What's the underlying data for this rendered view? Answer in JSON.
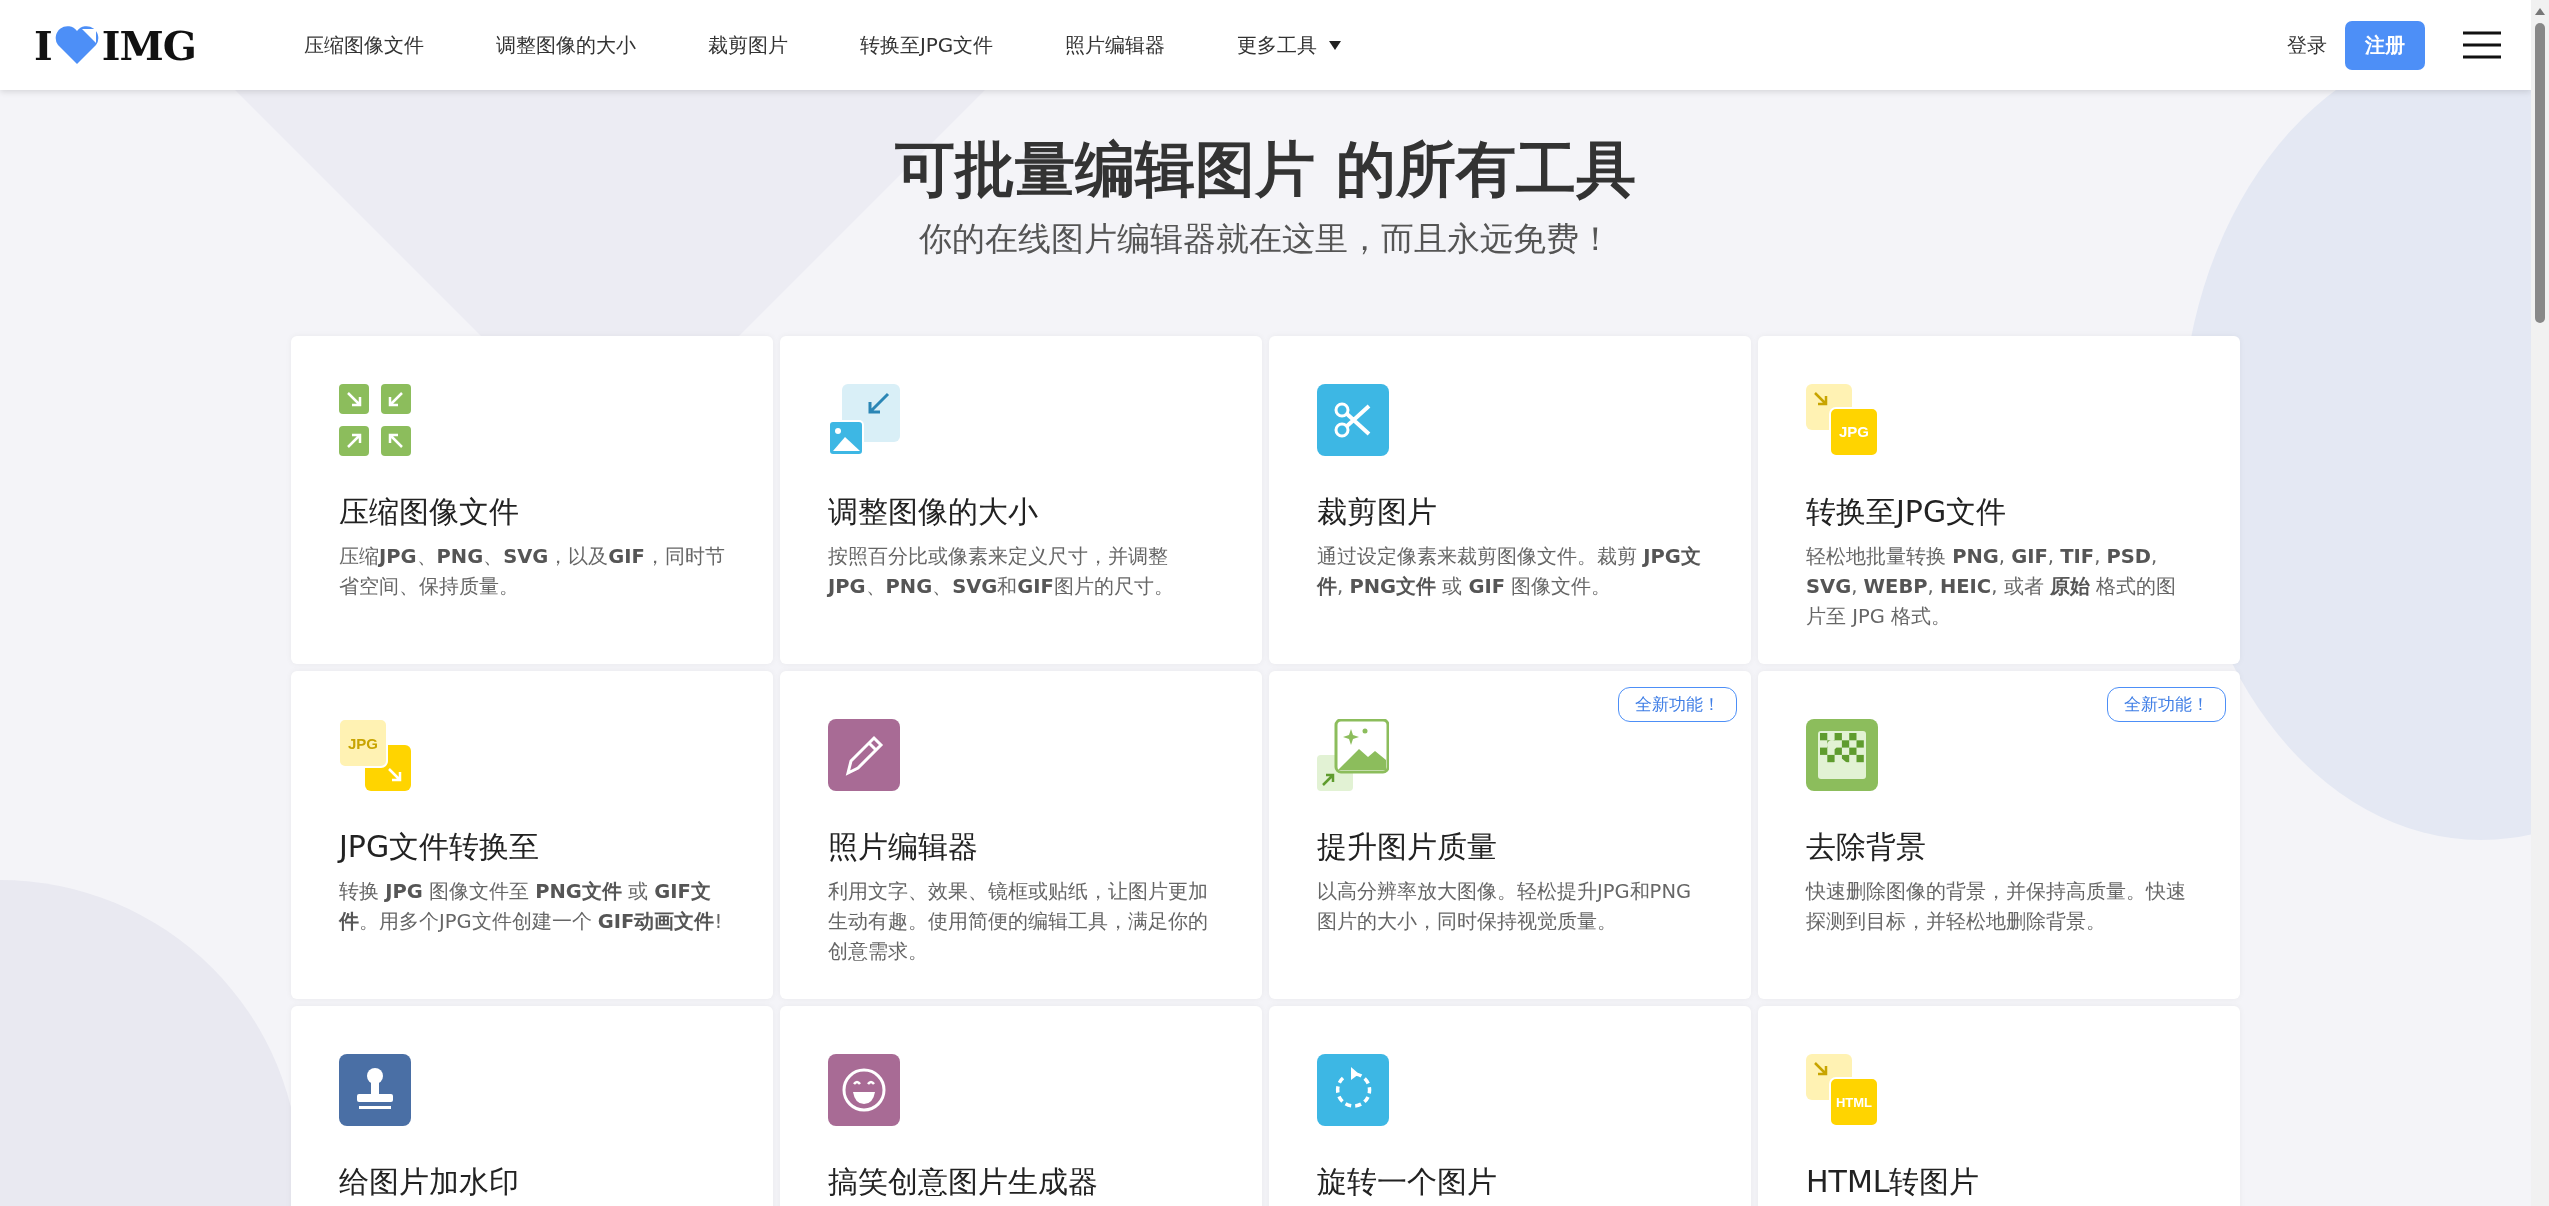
{
  "header": {
    "logo": {
      "left": "I",
      "right": "IMG"
    },
    "nav": [
      {
        "label": "压缩图像文件",
        "dropdown": false
      },
      {
        "label": "调整图像的大小",
        "dropdown": false
      },
      {
        "label": "裁剪图片",
        "dropdown": false
      },
      {
        "label": "转换至JPG文件",
        "dropdown": false
      },
      {
        "label": "照片编辑器",
        "dropdown": false
      },
      {
        "label": "更多工具",
        "dropdown": true
      }
    ],
    "login": "登录",
    "signup": "注册"
  },
  "hero": {
    "title": "可批量编辑图片 的所有工具",
    "subtitle": "你的在线图片编辑器就在这里，而且永远免费！"
  },
  "tools": [
    {
      "kind": "compress",
      "title": "压缩图像文件",
      "description": "压缩**JPG**、**PNG**、**SVG**，以及**GIF**，同时节省空间、保持质量。"
    },
    {
      "kind": "resize",
      "title": "调整图像的大小",
      "description": "按照百分比或像素来定义尺寸，并调整**JPG**、**PNG**、**SVG**和**GIF**图片的尺寸。"
    },
    {
      "kind": "crop",
      "title": "裁剪图片",
      "description": "通过设定像素来裁剪图像文件。裁剪 **JPG文件**, **PNG文件** 或 **GIF** 图像文件。"
    },
    {
      "kind": "to_format",
      "icon_text": "JPG",
      "title": "转换至JPG文件",
      "description": "轻松地批量转换 **PNG**, **GIF**, **TIF**, **PSD**, **SVG**, **WEBP**, **HEIC**, 或者 **原始** 格式的图片至 JPG 格式。"
    },
    {
      "kind": "from_format",
      "icon_text": "JPG",
      "title": "JPG文件转换至",
      "description": "转换 **JPG** 图像文件至 **PNG文件** 或 **GIF文件**。用多个JPG文件创建一个 **GIF动画文件**!"
    },
    {
      "kind": "edit",
      "title": "照片编辑器",
      "description": "利用文字、效果、镜框或贴纸，让图片更加生动有趣。使用简便的编辑工具，满足你的创意需求。"
    },
    {
      "kind": "upscale",
      "badge": "全新功能！",
      "title": "提升图片质量",
      "description": "以高分辨率放大图像。轻松提升JPG和PNG图片的大小，同时保持视觉质量。"
    },
    {
      "kind": "remove_bg",
      "badge": "全新功能！",
      "title": "去除背景",
      "description": "快速删除图像的背景，并保持高质量。快速探测到目标，并轻松地删除背景。"
    },
    {
      "kind": "watermark",
      "title": "给图片加水印"
    },
    {
      "kind": "meme",
      "title": "搞笑创意图片生成器"
    },
    {
      "kind": "rotate",
      "title": "旋转一个图片"
    },
    {
      "kind": "to_format",
      "icon_text": "HTML",
      "title": "HTML转图片"
    }
  ]
}
